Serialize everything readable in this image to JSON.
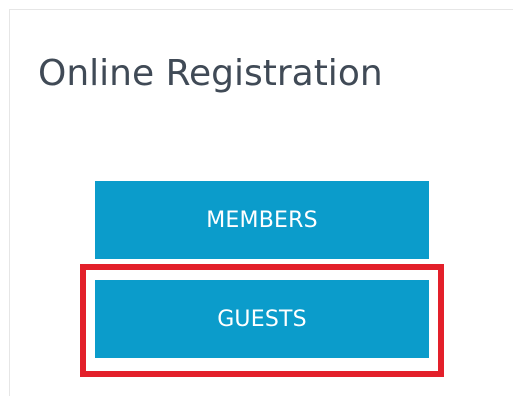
{
  "page": {
    "title": "Online Registration"
  },
  "buttons": {
    "members_label": "MEMBERS",
    "guests_label": "GUESTS"
  },
  "colors": {
    "button_bg": "#0b9ccb",
    "button_text": "#ffffff",
    "title_text": "#404a56",
    "highlight_border": "#e3202a",
    "card_border": "#e6e6e6"
  }
}
